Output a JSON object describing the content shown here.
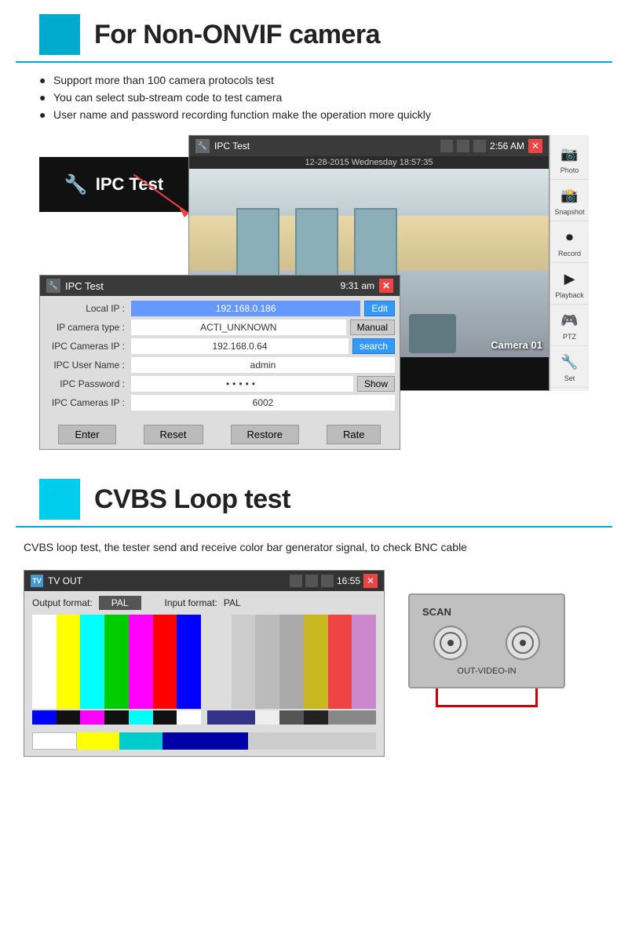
{
  "section1": {
    "title": "For Non-ONVIF camera",
    "bullets": [
      "Support more than 100 camera protocols test",
      "You can select sub-stream code to test camera",
      "User name and password recording function make the operation more quickly"
    ]
  },
  "ipc_big": {
    "title": "IPC Test",
    "datetime": "12-28-2015 Wednesday 18:57:35",
    "time": "2:56 AM",
    "camera_label": "Camera 01"
  },
  "ipc_small": {
    "title": "IPC Test",
    "time": "9:31 am",
    "fields": {
      "local_ip_label": "Local IP :",
      "local_ip_value": "192.168.0.186",
      "local_ip_btn": "Edit",
      "cam_type_label": "IP camera type :",
      "cam_type_value": "ACTI_UNKNOWN",
      "cam_type_btn": "Manual",
      "cam_ip_label": "IPC Cameras IP :",
      "cam_ip_value": "192.168.0.64",
      "cam_ip_btn": "search",
      "user_label": "IPC User Name :",
      "user_value": "admin",
      "pass_label": "IPC Password :",
      "pass_value": "• • • • •",
      "pass_btn": "Show",
      "port_label": "IPC Cameras IP :",
      "port_value": "6002"
    },
    "buttons": [
      "Enter",
      "Reset",
      "Restore",
      "Rate"
    ]
  },
  "side_panel": [
    {
      "label": "Photo",
      "icon": "📷"
    },
    {
      "label": "Snapshot",
      "icon": "📸"
    },
    {
      "label": "Record",
      "icon": "⏺"
    },
    {
      "label": "Playback",
      "icon": "▶"
    },
    {
      "label": "PTZ",
      "icon": "🎮"
    },
    {
      "label": "Set",
      "icon": "🔧"
    }
  ],
  "section2": {
    "title": "CVBS Loop test",
    "desc": "CVBS loop test, the tester send and receive color bar generator signal, to check BNC cable"
  },
  "tvout": {
    "title": "TV OUT",
    "time": "16:55",
    "output_format_label": "Output format:",
    "output_format_value": "PAL",
    "input_format_label": "Input format:",
    "input_format_value": "PAL",
    "colors_left": [
      "#fff",
      "#ff0",
      "#0ff",
      "#0f0",
      "#f0f",
      "#f00",
      "#00f"
    ],
    "colors_right": [
      "#ccc",
      "#ccc",
      "#aaa",
      "#999",
      "#bbb",
      "#eee",
      "#ddd"
    ],
    "bottom_colors": [
      "#f00",
      "#0f0",
      "#00f",
      "#ff0",
      "#0ff",
      "#f0f",
      "#888"
    ]
  },
  "scan": {
    "label": "SCAN",
    "out_label": "OUT-VIDEO-IN"
  }
}
